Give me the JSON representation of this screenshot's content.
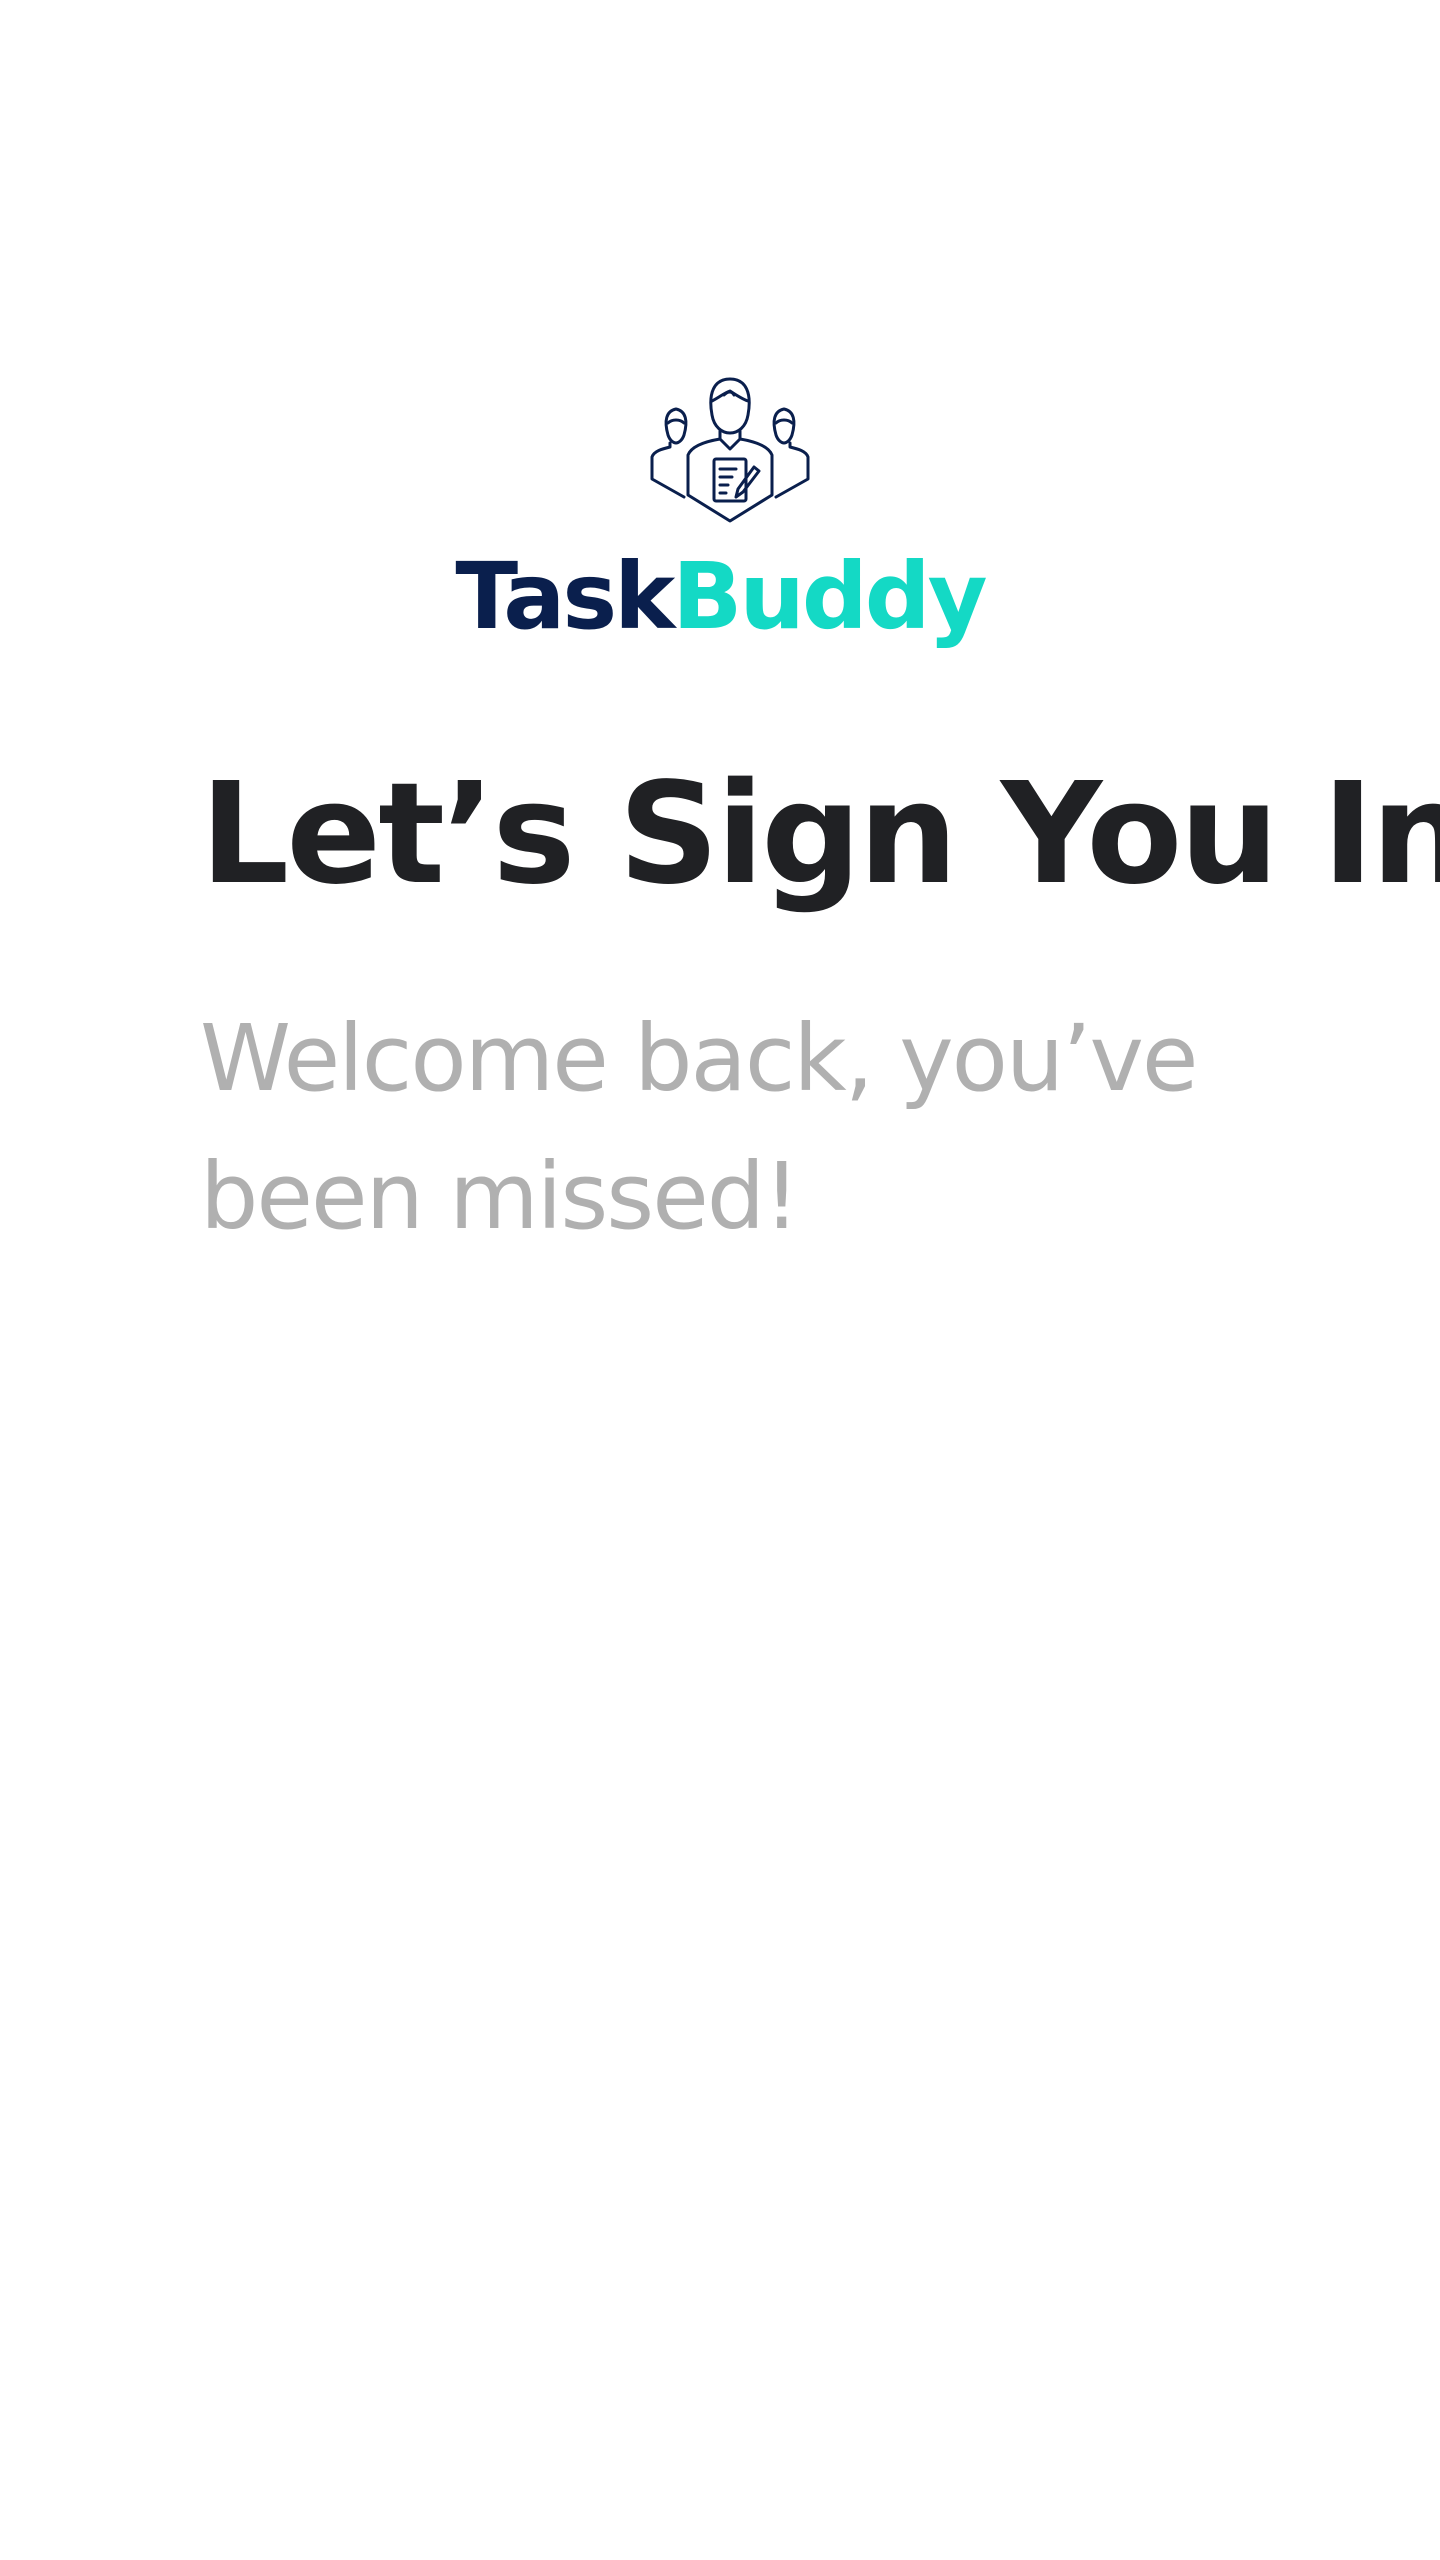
{
  "brand": {
    "name_part1": "Task",
    "name_part2": "Buddy",
    "logo_icon": "team-document-icon",
    "colors": {
      "navy": "#0a1f4d",
      "teal": "#14d9c5"
    }
  },
  "header": {
    "title": "Let’s Sign You In",
    "subtitle": "Welcome back, you’ve been missed!"
  },
  "colors": {
    "background": "#ffffff",
    "title": "#202124",
    "subtitle": "#b0b0b0"
  }
}
